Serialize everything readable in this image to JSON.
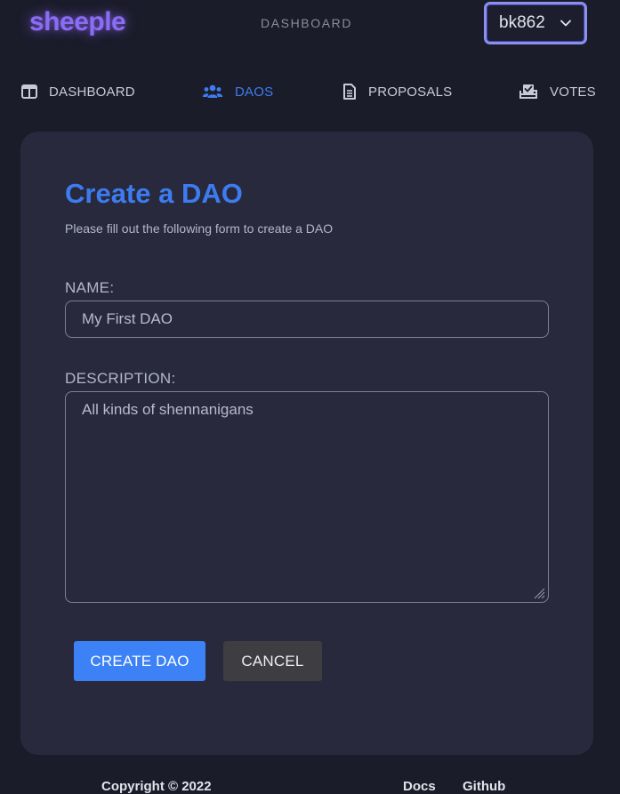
{
  "header": {
    "logo": "sheeple",
    "title": "DASHBOARD",
    "user_select": {
      "value": "bk862"
    }
  },
  "nav": {
    "items": [
      {
        "label": "DASHBOARD",
        "icon": "dashboard-icon",
        "active": false
      },
      {
        "label": "DAOS",
        "icon": "users-icon",
        "active": true
      },
      {
        "label": "PROPOSALS",
        "icon": "document-icon",
        "active": false
      },
      {
        "label": "VOTES",
        "icon": "ballot-box-icon",
        "active": false
      }
    ]
  },
  "form": {
    "title": "Create a DAO",
    "subtitle": "Please fill out the following form to create a DAO",
    "name_label": "NAME:",
    "name_value": "My First DAO",
    "description_label": "DESCRIPTION:",
    "description_value": "All kinds of shennanigans",
    "create_button": "CREATE DAO",
    "cancel_button": "CANCEL"
  },
  "footer": {
    "copyright": "Copyright © 2022",
    "links": [
      "Docs",
      "Github"
    ]
  },
  "colors": {
    "background": "#1b1c2a",
    "card": "#28293d",
    "accent": "#3d7cf0",
    "logo": "#8b6cf4",
    "primary_button": "#3c82f6",
    "secondary_button": "#3d3d42"
  }
}
